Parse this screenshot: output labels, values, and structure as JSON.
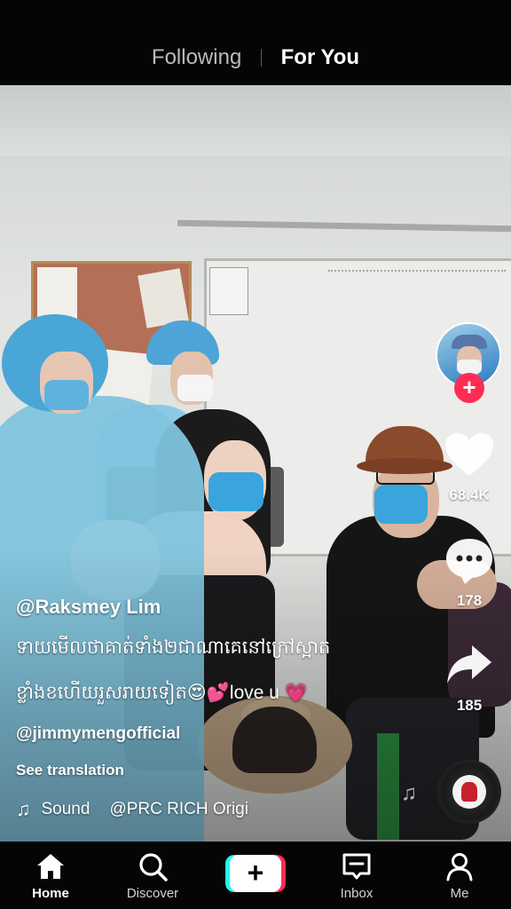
{
  "header": {
    "tabs": [
      {
        "label": "Following",
        "active": false
      },
      {
        "label": "For You",
        "active": true
      }
    ]
  },
  "video": {
    "author": "@Raksmey Lim",
    "caption_line1": "ទាយមើលថាគាត់ទាំង២ជាណាគេនៅក្រៅស្អាត",
    "caption_line2": "ខ្លាំងខហើយរួសរាយទៀត😍💕love u 💗",
    "mention": "@jimmymengofficial",
    "see_translation": "See translation",
    "sound_label": "Sound",
    "sound_name": "@PRC RICH Origi"
  },
  "actions": {
    "like_count": "68.4K",
    "comment_count": "178",
    "share_count": "185",
    "follow_symbol": "+"
  },
  "icons": {
    "like": "heart-icon",
    "comment": "comment-icon",
    "share": "share-icon",
    "sound": "music-note-icon",
    "disc": "music-disc-icon"
  },
  "bottom_nav": {
    "items": [
      {
        "label": "Home",
        "icon": "home-icon",
        "active": true
      },
      {
        "label": "Discover",
        "icon": "search-icon",
        "active": false
      },
      {
        "label": "+",
        "icon": "create-icon",
        "active": false
      },
      {
        "label": "Inbox",
        "icon": "inbox-icon",
        "active": false
      },
      {
        "label": "Me",
        "icon": "profile-icon",
        "active": false
      }
    ]
  },
  "colors": {
    "accent_red": "#fe2c55",
    "accent_cyan": "#25f4ee",
    "bar_bg": "#050505"
  }
}
